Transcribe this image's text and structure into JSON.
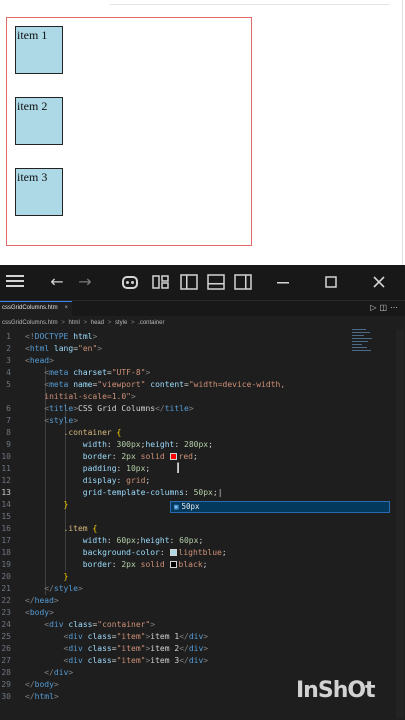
{
  "preview": {
    "items": [
      "item 1",
      "item 2",
      "item 3"
    ]
  },
  "titlebar": {
    "icons": [
      "menu-icon",
      "back-arrow-icon",
      "forward-arrow-icon",
      "copilot-icon",
      "layout-icon",
      "sidebar-left-icon",
      "panel-bottom-icon",
      "sidebar-right-icon",
      "minimize-icon",
      "maximize-icon",
      "close-icon"
    ]
  },
  "tab": {
    "label": "cssGridColumns.htm",
    "close": "×"
  },
  "breadcrumb": [
    "cssGridColumns.htm",
    ">",
    "html",
    ">",
    "head",
    ">",
    "style",
    ">",
    ".container"
  ],
  "code": {
    "line_numbers": [
      "1",
      "2",
      "3",
      "4",
      "5",
      "",
      "6",
      "7",
      "8",
      "9",
      "10",
      "11",
      "12",
      "13",
      "14",
      "15",
      "16",
      "17",
      "18",
      "19",
      "20",
      "21",
      "22",
      "23",
      "24",
      "25",
      "26",
      "27",
      "28",
      "29",
      "30",
      "31"
    ]
  },
  "suggestion": {
    "text": "50px"
  },
  "watermark": "InShOt",
  "colors": {
    "editor_bg": "#1e1e1e",
    "tag": "#569cd6",
    "attr": "#9cdcfe",
    "string": "#ce9178",
    "selector": "#d7ba7d",
    "container_border": "#e06a6a",
    "item_bg": "#add8e6",
    "swatch_red": "#ff0000",
    "swatch_lightblue": "#add8e6",
    "swatch_black": "#000000"
  }
}
